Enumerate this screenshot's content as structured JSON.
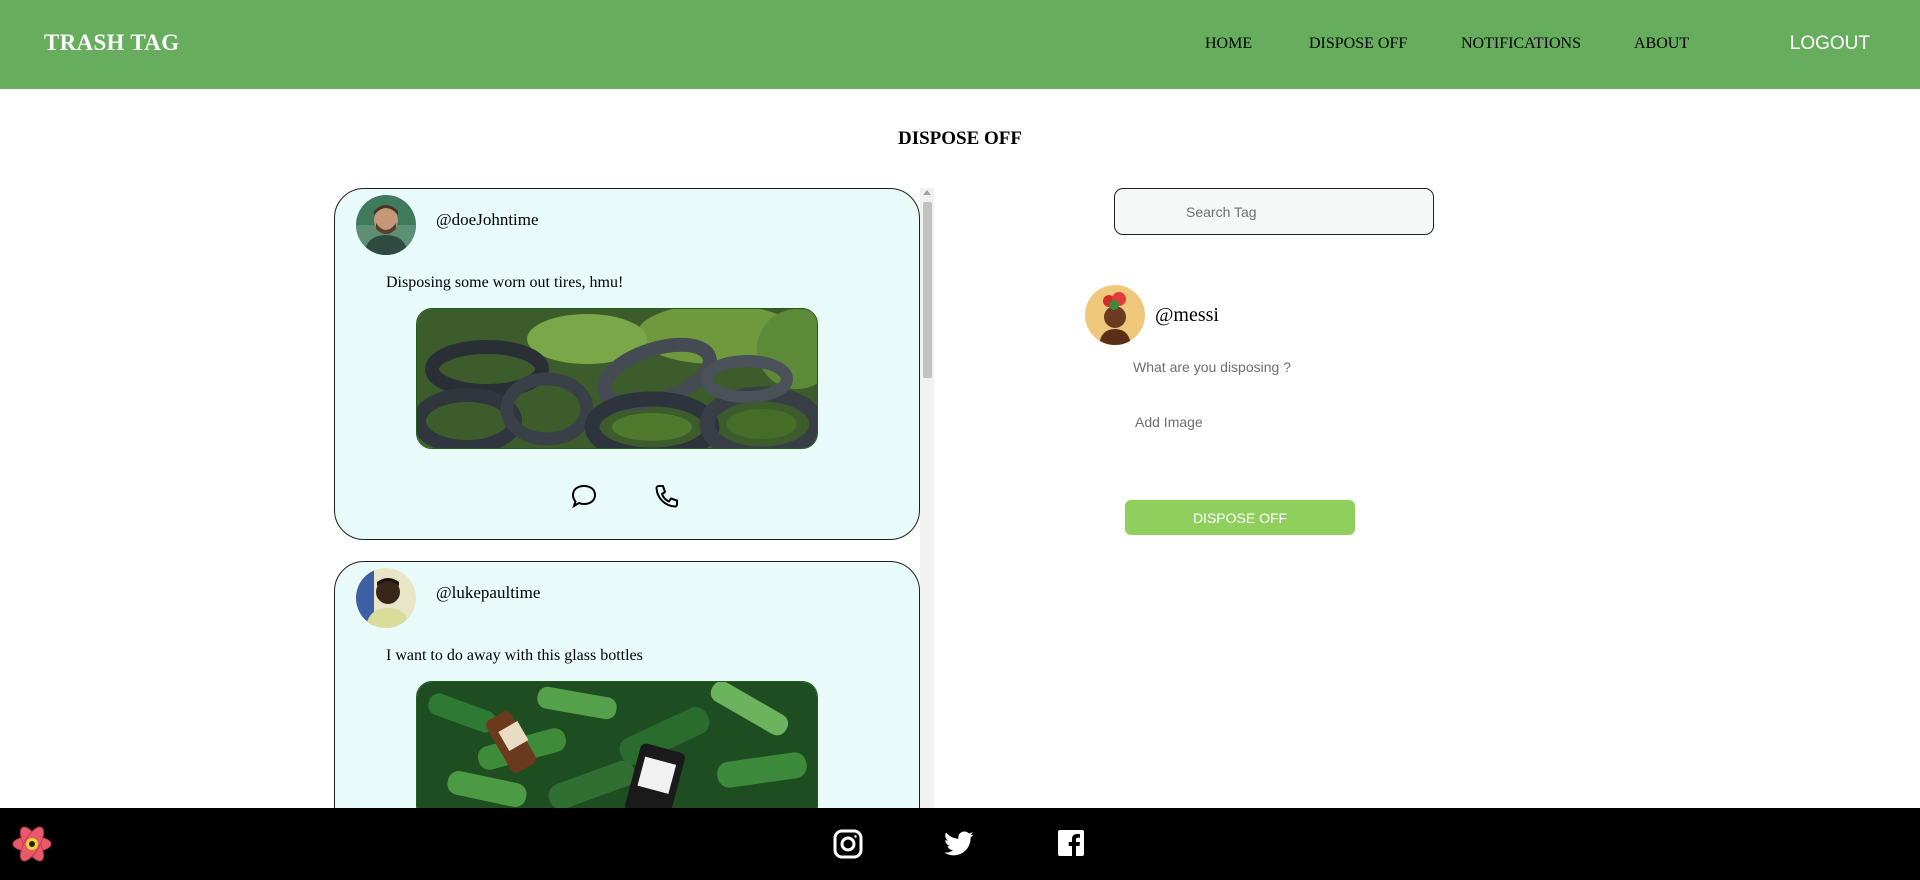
{
  "header": {
    "brand": "TRASH TAG",
    "nav": [
      "HOME",
      "DISPOSE OFF",
      "NOTIFICATIONS",
      "ABOUT"
    ],
    "logout": "LOGOUT",
    "bg_color": "#66ae5d"
  },
  "page_title": "DISPOSE OFF",
  "posts": [
    {
      "username": "@doeJohntime",
      "text": "Disposing some worn out tires, hmu!",
      "image": "worn-tires-photo",
      "actions": [
        "comment-icon",
        "phone-icon"
      ]
    },
    {
      "username": "@lukepaultime",
      "text": "I want to do away with this glass bottles",
      "image": "glass-bottles-photo"
    }
  ],
  "search": {
    "placeholder": "Search Tag"
  },
  "composer": {
    "username": "@messi",
    "input_placeholder": "What are you disposing ?",
    "add_image": "Add Image",
    "submit": "DISPOSE OFF",
    "submit_color": "#8fcf5e"
  },
  "footer": {
    "icons": [
      "react-logo-icon",
      "instagram-icon",
      "twitter-icon",
      "facebook-icon"
    ]
  }
}
